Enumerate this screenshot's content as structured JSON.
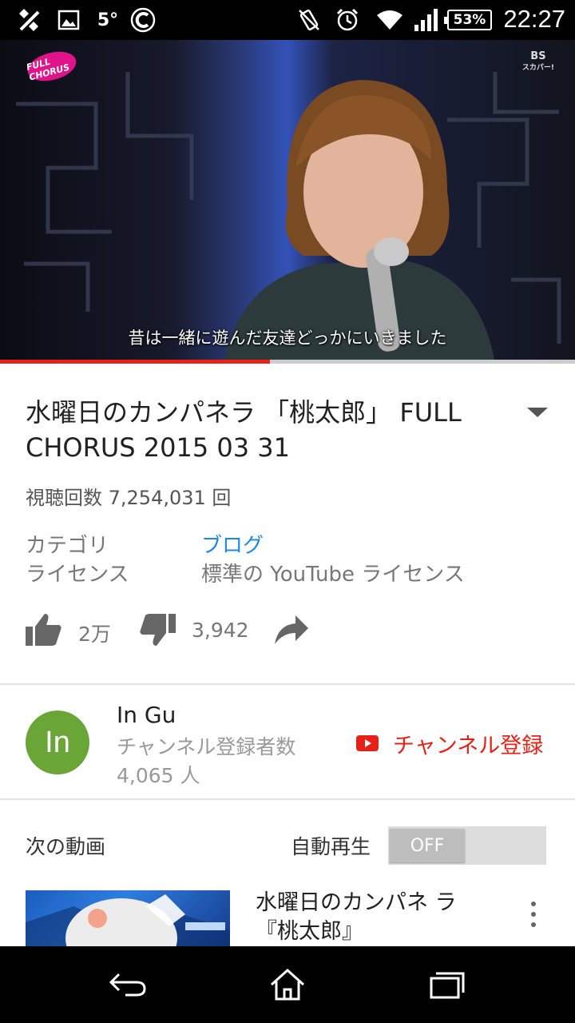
{
  "status_bar": {
    "icons": [
      "crossed-tools-icon",
      "image-icon",
      "weather-temp",
      "app-c-icon",
      "vibrate-icon",
      "alarm-icon",
      "wifi-icon",
      "signal-icon",
      "battery-icon"
    ],
    "temperature": "5°",
    "battery": "53%",
    "time": "22:27"
  },
  "video": {
    "channel_logo": "FULL CHORUS",
    "broadcaster_logo_line1": "BS",
    "broadcaster_logo_line2": "スカパー!",
    "subtitle": "昔は一緒に遊んだ友達どっかにいきました",
    "progress_played": 0.47,
    "progress_buffered": 0.915,
    "colors": {
      "played": "#e62117",
      "buffered": "#cccccc"
    }
  },
  "details": {
    "title": "水曜日のカンパネラ 「桃太郎」 FULL CHORUS 2015 03 31",
    "views": "視聴回数 7,254,031 回",
    "category_label": "カテゴリ",
    "category_value": "ブログ",
    "license_label": "ライセンス",
    "license_value": "標準の YouTube ライセンス",
    "likes": "2万",
    "dislikes": "3,942"
  },
  "channel": {
    "avatar_text": "In",
    "avatar_color": "#6aa637",
    "name": "In Gu",
    "subscriber_label": "チャンネル登録者数",
    "subscriber_count": "4,065 人",
    "subscribe_label": "チャンネル登録"
  },
  "up_next": {
    "label": "次の動画",
    "autoplay_label": "自動再生",
    "autoplay_state": "OFF",
    "items": [
      {
        "title": "水曜日のカンパネ ラ『桃太郎』"
      }
    ]
  }
}
